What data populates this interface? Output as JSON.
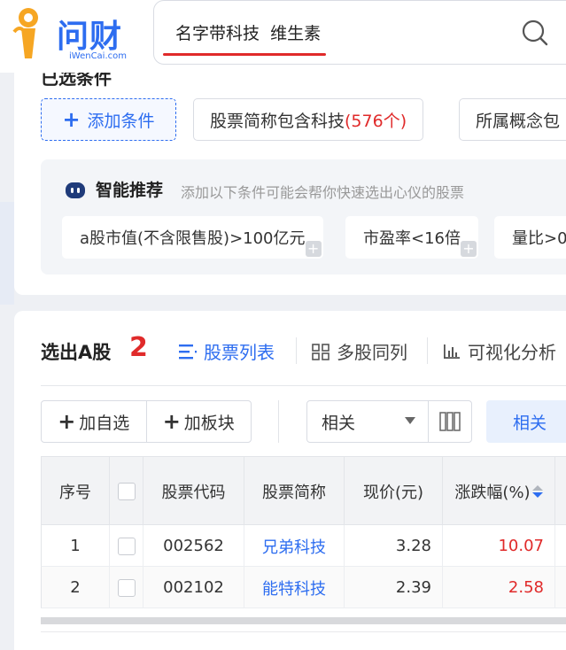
{
  "header": {
    "logo_text": "问财",
    "logo_sub": "iWenCai.com",
    "search_query": "名字带科技  维生素"
  },
  "conditions": {
    "title": "已选条件",
    "add_label": "添加条件",
    "chips": [
      {
        "label": "股票简称包含科技 ",
        "count": "(576个)"
      },
      {
        "label": "所属概念包",
        "count": ""
      }
    ]
  },
  "recommend": {
    "title": "智能推荐",
    "desc": "添加以下条件可能会帮你快速选出心仪的股票",
    "items": [
      {
        "label": "a股市值(不含限售股)>100亿元"
      },
      {
        "label": "市盈率<16倍"
      },
      {
        "label": "量比>0"
      }
    ]
  },
  "results": {
    "title": "选出A股",
    "count": "2",
    "tabs": [
      {
        "label": "股票列表",
        "icon": "list-icon",
        "active": true
      },
      {
        "label": "多股同列",
        "icon": "grid-icon",
        "active": false
      },
      {
        "label": "可视化分析",
        "icon": "bar-chart-icon",
        "active": false
      }
    ],
    "add_watchlist": "加自选",
    "add_sector": "加板块",
    "sort_select": "相关",
    "sort_button": "相关"
  },
  "table": {
    "columns": [
      "序号",
      "",
      "股票代码",
      "股票简称",
      "现价(元)",
      "涨跌幅(%)"
    ],
    "rows": [
      {
        "index": "1",
        "code": "002562",
        "name": "兄弟科技",
        "price": "3.28",
        "change": "10.07"
      },
      {
        "index": "2",
        "code": "002102",
        "name": "能特科技",
        "price": "2.39",
        "change": "2.58"
      }
    ]
  },
  "colors": {
    "accent": "#2d6df0",
    "up": "#e02a2a"
  }
}
